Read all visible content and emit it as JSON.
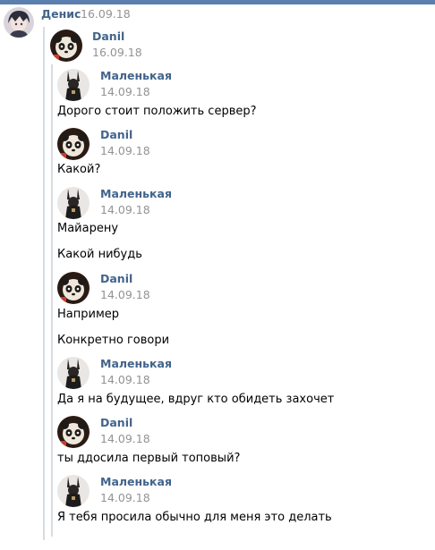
{
  "top_message": {
    "author": "Денис",
    "date": "16.09.18",
    "avatar_icon": "anime-boy-avatar-icon"
  },
  "forward_outer": {
    "author": "Danil",
    "date": "16.09.18",
    "avatar_icon": "panda-avatar-icon"
  },
  "messages": [
    {
      "author": "Маленькая",
      "date": "14.09.18",
      "avatar_icon": "bunny-girl-avatar-icon",
      "texts": [
        "Дорого стоит положить сервер?"
      ]
    },
    {
      "author": "Danil",
      "date": "14.09.18",
      "avatar_icon": "panda-avatar-icon",
      "texts": [
        "Какой?"
      ]
    },
    {
      "author": "Маленькая",
      "date": "14.09.18",
      "avatar_icon": "bunny-girl-avatar-icon",
      "texts": [
        "Майарену",
        "Какой нибудь"
      ]
    },
    {
      "author": "Danil",
      "date": "14.09.18",
      "avatar_icon": "panda-avatar-icon",
      "texts": [
        "Например",
        "Конкретно говори"
      ]
    },
    {
      "author": "Маленькая",
      "date": "14.09.18",
      "avatar_icon": "bunny-girl-avatar-icon",
      "texts": [
        "Да я на будущее, вдруг кто обидеть захочет"
      ]
    },
    {
      "author": "Danil",
      "date": "14.09.18",
      "avatar_icon": "panda-avatar-icon",
      "texts": [
        "ты ддосила первый топовый?"
      ]
    },
    {
      "author": "Маленькая",
      "date": "14.09.18",
      "avatar_icon": "bunny-girl-avatar-icon",
      "texts": [
        "Я тебя просила обычно для меня это делать"
      ]
    }
  ],
  "colors": {
    "accent_bar": "#5b7faf",
    "author_name": "#42648b",
    "date": "#939393",
    "forward_line": "#d7dce3"
  }
}
